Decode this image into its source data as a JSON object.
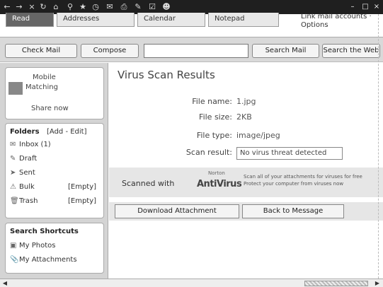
{
  "toolbar": {
    "icons": [
      "back-icon",
      "forward-icon",
      "stop-icon",
      "refresh-icon",
      "home-icon",
      "search-icon",
      "favorites-icon",
      "history-icon",
      "mail-icon",
      "print-icon",
      "edit-icon",
      "discuss-icon",
      "messenger-icon"
    ],
    "window_controls": [
      "minimize-icon",
      "maximize-icon",
      "close-icon"
    ]
  },
  "tabs": [
    {
      "label": "Read"
    },
    {
      "label": "Addresses"
    },
    {
      "label": "Calendar"
    },
    {
      "label": "Notepad"
    }
  ],
  "link_options": "Link mail accounts · Options",
  "actions": {
    "check_mail": "Check Mail",
    "compose": "Compose",
    "search_input_value": "",
    "search_mail": "Search Mail",
    "search_the_web": "Search the Web"
  },
  "sidebar": {
    "promo_line1": "Mobile",
    "promo_line2": "Matching",
    "promo_line3": "Share now",
    "folders_title": "Folders",
    "folders_actions": "[Add - Edit]",
    "folders": [
      {
        "name": "Inbox (1)",
        "count": ""
      },
      {
        "name": "Draft",
        "count": ""
      },
      {
        "name": "Sent",
        "count": ""
      },
      {
        "name": "Bulk",
        "count": "[Empty]"
      },
      {
        "name": "Trash",
        "count": "[Empty]"
      }
    ],
    "search_title": "Search Shortcuts",
    "shortcuts": [
      "My Photos",
      "My Attachments"
    ]
  },
  "main": {
    "title": "Virus Scan Results",
    "file_name_label": "File name:",
    "file_name_value": "1.jpg",
    "file_size_label": "File size:",
    "file_size_value": "2KB",
    "file_type_label": "File type:",
    "file_type_value": "image/jpeg",
    "scan_result_label": "Scan result:",
    "scan_result_value": "No virus threat detected",
    "scanned_with_label": "Scanned with",
    "av_brand": "AntiVirus",
    "av_brand_sub": "Norton",
    "av_blurb_line1": "Scan all of your attachments for viruses for free",
    "av_blurb_line2": "Protect your computer from viruses now",
    "download_button": "Download Attachment",
    "back_button": "Back to Message"
  }
}
